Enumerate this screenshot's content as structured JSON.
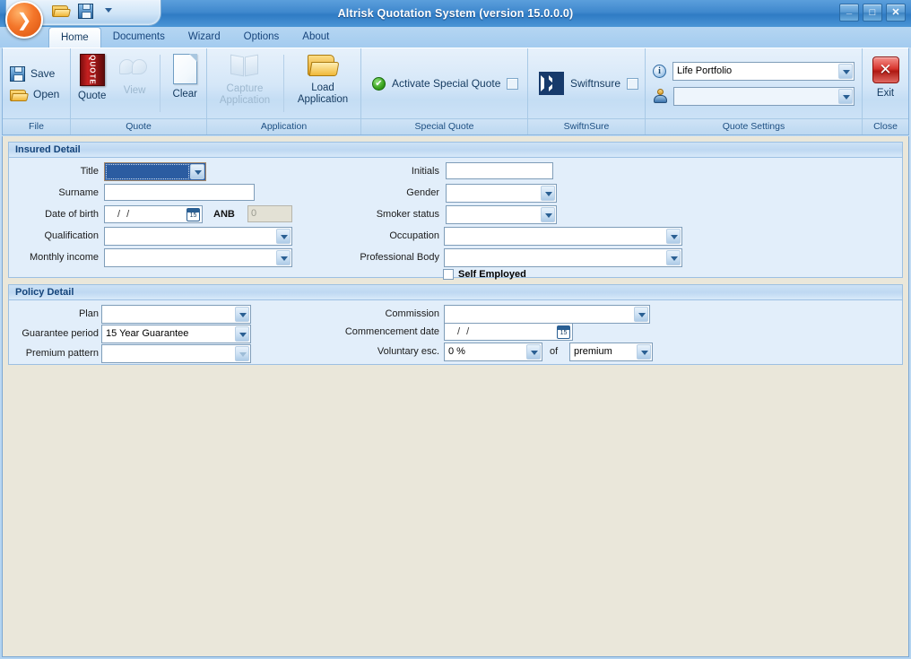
{
  "window": {
    "title": "Altrisk Quotation System (version 15.0.0.0)",
    "orb_glyph": "❯",
    "minimize": "_",
    "maximize": "□",
    "close": "✕"
  },
  "quick_access": {
    "open_icon": "folder-open-icon",
    "save_icon": "floppy-save-icon",
    "more_icon": "chevron-down-icon"
  },
  "tabs": [
    {
      "label": "Home",
      "active": true
    },
    {
      "label": "Documents",
      "active": false
    },
    {
      "label": "Wizard",
      "active": false
    },
    {
      "label": "Options",
      "active": false
    },
    {
      "label": "About",
      "active": false
    }
  ],
  "ribbon": {
    "groups": [
      {
        "title": "File",
        "buttons": [
          {
            "label": "Save",
            "icon": "floppy-save-icon"
          },
          {
            "label": "Open",
            "icon": "folder-open-icon"
          }
        ]
      },
      {
        "title": "Quote",
        "buttons": [
          {
            "label": "Quote",
            "icon": "quote-book-icon",
            "disabled": false
          },
          {
            "label": "View",
            "icon": "view-glasses-icon",
            "disabled": true
          },
          {
            "label": "Clear",
            "icon": "blank-page-icon",
            "disabled": false
          }
        ]
      },
      {
        "title": "Application",
        "buttons": [
          {
            "label": "Capture\nApplication",
            "label_line1": "Capture",
            "label_line2": "Application",
            "icon": "capture-book-icon",
            "disabled": true
          },
          {
            "label_line1": "Load",
            "label_line2": "Application",
            "icon": "folder-open-large-icon",
            "disabled": false
          }
        ]
      },
      {
        "title": "Special Quote",
        "check_label": "Activate Special Quote",
        "check_icon": "green-check-icon",
        "checked": false
      },
      {
        "title": "SwiftnSure",
        "check_label": "Swiftnsure",
        "check_icon": "swiftnsure-chevron-icon",
        "checked": false
      },
      {
        "title": "Quote Settings",
        "rows": [
          {
            "icon": "info-icon",
            "value": "Life Portfolio"
          },
          {
            "icon": "user-icon",
            "value": ""
          }
        ]
      },
      {
        "title": "Close",
        "buttons": [
          {
            "label": "Exit",
            "icon": "exit-red-x-icon"
          }
        ]
      }
    ]
  },
  "insured_detail": {
    "header": "Insured Detail",
    "fields": {
      "title": {
        "label": "Title",
        "value": "",
        "focused": true
      },
      "surname": {
        "label": "Surname",
        "value": ""
      },
      "date_of_birth": {
        "label": "Date of birth",
        "value": " /  / "
      },
      "anb": {
        "label": "ANB",
        "value": "0"
      },
      "qualification": {
        "label": "Qualification",
        "value": ""
      },
      "monthly_income": {
        "label": "Monthly income",
        "value": ""
      },
      "initials": {
        "label": "Initials",
        "value": ""
      },
      "gender": {
        "label": "Gender",
        "value": ""
      },
      "smoker_status": {
        "label": "Smoker status",
        "value": ""
      },
      "occupation": {
        "label": "Occupation",
        "value": ""
      },
      "professional_body": {
        "label": "Professional Body",
        "value": ""
      },
      "self_employed": {
        "label": "Self Employed",
        "checked": false
      }
    }
  },
  "policy_detail": {
    "header": "Policy Detail",
    "fields": {
      "plan": {
        "label": "Plan",
        "value": ""
      },
      "guarantee_period": {
        "label": "Guarantee period",
        "value": "15 Year Guarantee"
      },
      "premium_pattern": {
        "label": "Premium pattern",
        "value": ""
      },
      "commission": {
        "label": "Commission",
        "value": ""
      },
      "commencement_date": {
        "label": "Commencement date",
        "value": " /  / "
      },
      "voluntary_esc": {
        "label": "Voluntary esc.",
        "value": "0 %",
        "of_label": "of",
        "of_value": "premium"
      }
    }
  },
  "colors": {
    "titlebar_blue": "#3f88cd",
    "ribbon_blue": "#d5e7f8",
    "panel_blue": "#e2eefa",
    "body_beige": "#eae7da",
    "accent_orange": "#f4762a",
    "swift_navy": "#173a6b",
    "exit_red": "#d8362f"
  }
}
